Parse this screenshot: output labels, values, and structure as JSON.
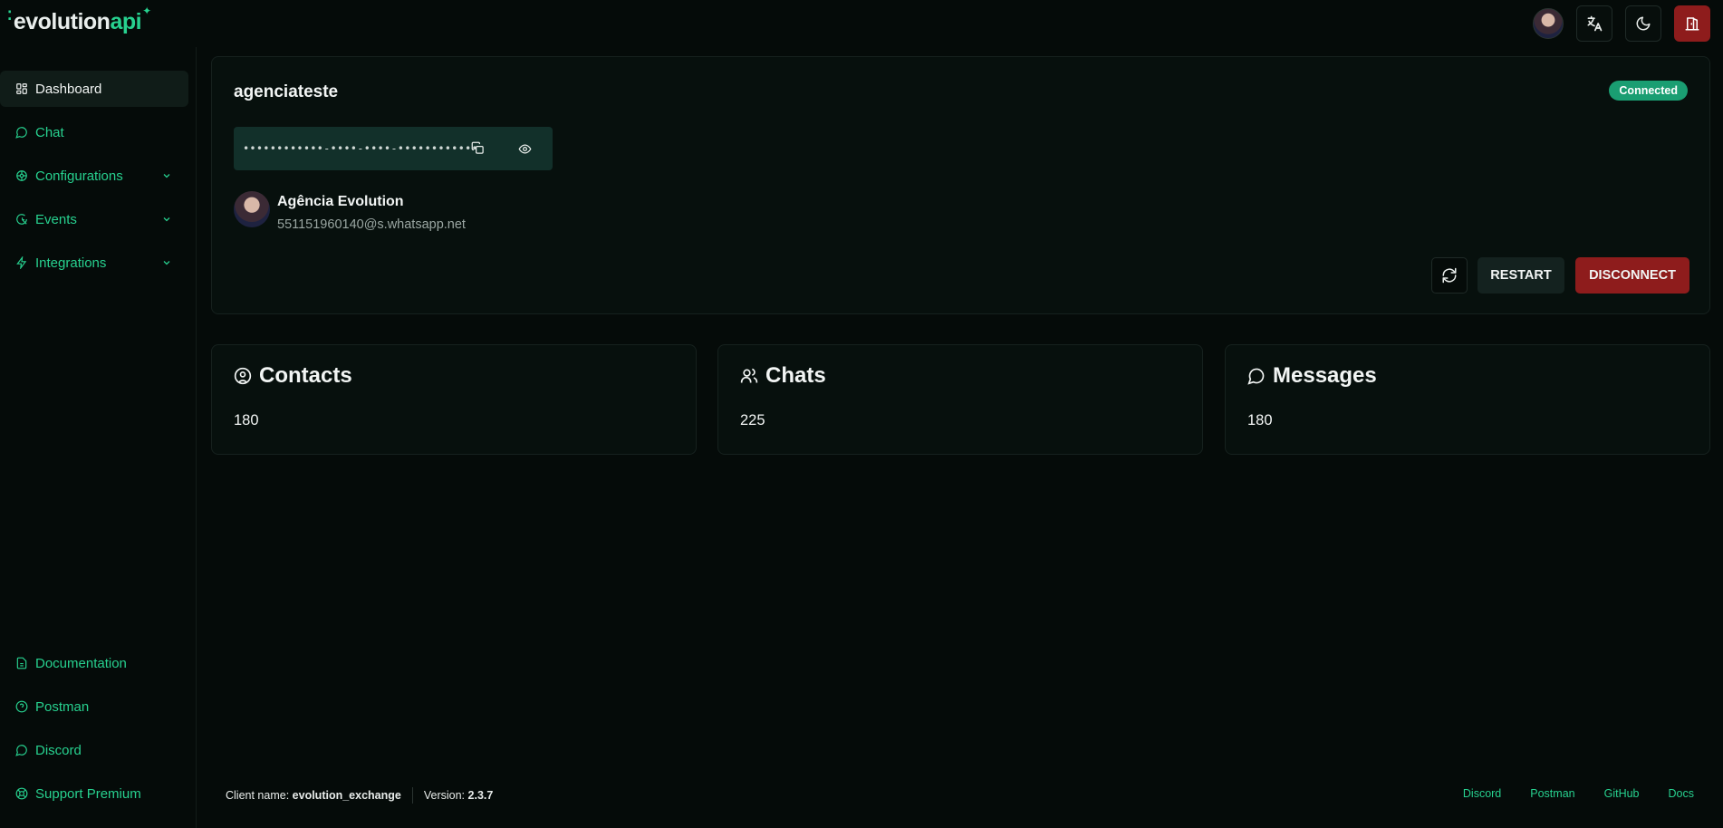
{
  "app": {
    "logo_part1": "evolution",
    "logo_part2": "api"
  },
  "header": {
    "avatar_icon": "user-avatar",
    "translate_icon": "translate-icon",
    "theme_icon": "moon-icon",
    "logout_icon": "logout-icon"
  },
  "sidebar": {
    "items": [
      {
        "label": "Dashboard",
        "icon": "dashboard-icon",
        "active": true
      },
      {
        "label": "Chat",
        "icon": "chat-icon"
      },
      {
        "label": "Configurations",
        "icon": "settings-icon",
        "expandable": true
      },
      {
        "label": "Events",
        "icon": "events-icon",
        "expandable": true
      },
      {
        "label": "Integrations",
        "icon": "bolt-icon",
        "expandable": true
      }
    ],
    "bottom_items": [
      {
        "label": "Documentation",
        "icon": "document-icon"
      },
      {
        "label": "Postman",
        "icon": "help-circle-icon"
      },
      {
        "label": "Discord",
        "icon": "chat-icon"
      },
      {
        "label": "Support Premium",
        "icon": "support-icon"
      }
    ]
  },
  "instance": {
    "name": "agenciateste",
    "status": "Connected",
    "token_masked": "••••••••••••-••••-••••-••••••••••••",
    "profile_name": "Agência Evolution",
    "jid": "551151960140@s.whatsapp.net",
    "restart_label": "RESTART",
    "disconnect_label": "DISCONNECT"
  },
  "stats": [
    {
      "title": "Contacts",
      "value": "180",
      "icon": "user-circle-icon"
    },
    {
      "title": "Chats",
      "value": "225",
      "icon": "users-icon"
    },
    {
      "title": "Messages",
      "value": "180",
      "icon": "message-icon"
    }
  ],
  "footer": {
    "client_label": "Client name:",
    "client_value": "evolution_exchange",
    "version_label": "Version:",
    "version_value": "2.3.7",
    "links": [
      "Discord",
      "Postman",
      "GitHub",
      "Docs"
    ]
  },
  "colors": {
    "background": "#050b09",
    "accent": "#27d18f",
    "danger": "#8e1c1c",
    "badge": "#1a9e72"
  }
}
